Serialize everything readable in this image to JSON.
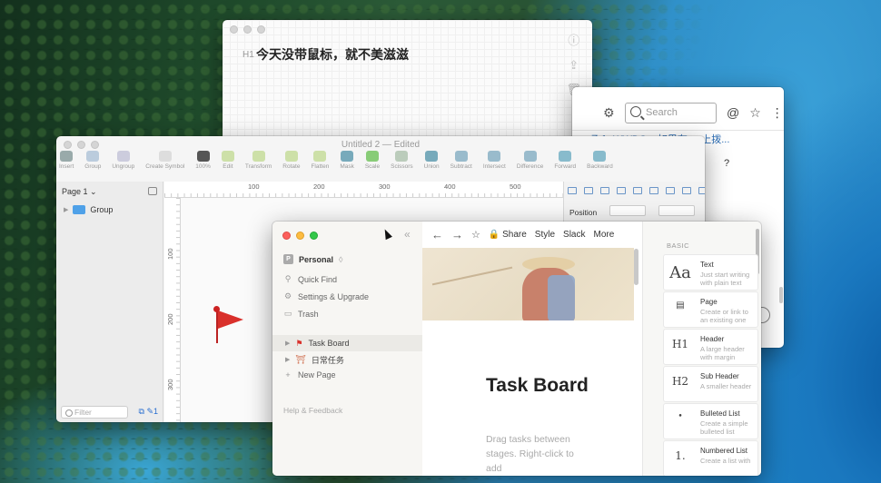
{
  "bear": {
    "heading_marker": "H1",
    "note_text": "今天没带鼠标，就不美滋滋",
    "side_icons": [
      "info-icon",
      "share-icon",
      "trash-icon"
    ]
  },
  "browser": {
    "search_placeholder": "Search",
    "link_text": "ㄋㄟ WWDC... 如果在 ... 上拨...",
    "question_mark": "?"
  },
  "sketch": {
    "title": "Untitled 2 — Edited",
    "tools": [
      "Insert",
      "Group",
      "Ungroup",
      "Create Symbol",
      "100%",
      "Edit",
      "Transform",
      "Rotate",
      "Flatten",
      "Mask",
      "Scale",
      "Scissors",
      "Union",
      "Subtract",
      "Intersect",
      "Difference",
      "Forward",
      "Backward"
    ],
    "page_selector": "Page 1",
    "layer_group": "Group",
    "filter_placeholder": "Filter",
    "ruler_top": [
      "100",
      "200",
      "300",
      "400",
      "500"
    ],
    "ruler_left": [
      "100",
      "200",
      "300"
    ],
    "position_label": "Position"
  },
  "notion": {
    "workspace": "Personal",
    "workspace_avatar": "P",
    "menu": [
      "Quick Find",
      "Settings & Upgrade",
      "Trash"
    ],
    "pages": [
      {
        "label": "Task Board",
        "active": true
      },
      {
        "label": "日常任务",
        "active": false
      }
    ],
    "new_page": "New Page",
    "help": "Help & Feedback",
    "toolbar": {
      "share": "Share",
      "style": "Style",
      "slack": "Slack",
      "more": "More"
    },
    "page_title": "Task Board",
    "page_desc": "Drag tasks between stages. Right-click to add",
    "blocks_heading": "BASIC",
    "blocks": [
      {
        "icon": "Aa",
        "name": "Text",
        "desc1": "Just start writing",
        "desc2": "with plain text"
      },
      {
        "icon": "▤",
        "name": "Page",
        "desc1": "Create or link to",
        "desc2": "an existing one"
      },
      {
        "icon": "H1",
        "name": "Header",
        "desc1": "A large header",
        "desc2": "with margin"
      },
      {
        "icon": "H2",
        "name": "Sub Header",
        "desc1": "A smaller header",
        "desc2": ""
      },
      {
        "icon": "•",
        "name": "Bulleted List",
        "desc1": "Create a simple",
        "desc2": "bulleted list"
      },
      {
        "icon": "1.",
        "name": "Numbered List",
        "desc1": "Create a list with",
        "desc2": ""
      }
    ]
  }
}
